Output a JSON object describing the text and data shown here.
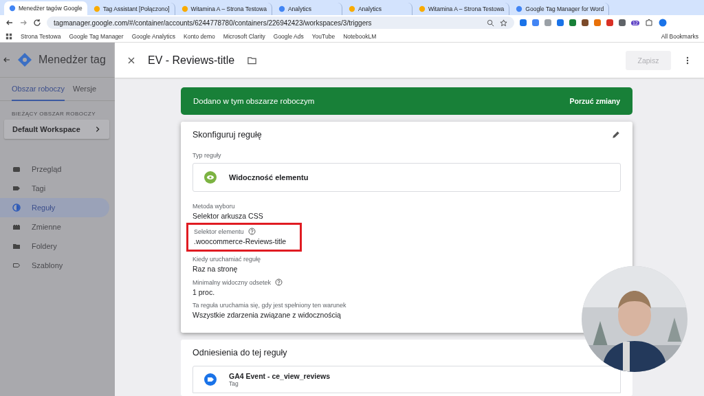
{
  "browser": {
    "tabs": [
      {
        "title": "Menedżer tagów Google",
        "selected": true
      },
      {
        "title": "Tag Assistant [Połączono]",
        "selected": false
      },
      {
        "title": "Witamina A – Strona Testowa",
        "selected": false
      },
      {
        "title": "Analytics",
        "selected": false
      },
      {
        "title": "Analytics",
        "selected": false
      },
      {
        "title": "Witamina A – Strona Testowa",
        "selected": false
      },
      {
        "title": "Google Tag Manager for Word",
        "selected": false
      }
    ],
    "url": "tagmanager.google.com/#/container/accounts/6244778780/containers/226942423/workspaces/3/triggers",
    "extension_badge": "12",
    "bookmarks": [
      "Strona Testowa",
      "Google Tag Manager",
      "Google Analytics",
      "Konto demo",
      "Microsoft Clarity",
      "Google Ads",
      "YouTube",
      "NotebookLM"
    ],
    "all_bookmarks": "All Bookmarks"
  },
  "sidebar": {
    "app_title": "Menedżer tag",
    "tabs": [
      {
        "label": "Obszar roboczy",
        "selected": true
      },
      {
        "label": "Wersje",
        "selected": false
      }
    ],
    "workspace_label": "BIEŻĄCY OBSZAR ROBOCZY",
    "workspace": "Default Workspace",
    "items": [
      {
        "label": "Przegląd",
        "selected": false
      },
      {
        "label": "Tagi",
        "selected": false
      },
      {
        "label": "Reguły",
        "selected": true
      },
      {
        "label": "Zmienne",
        "selected": false
      },
      {
        "label": "Foldery",
        "selected": false
      },
      {
        "label": "Szablony",
        "selected": false
      }
    ]
  },
  "editor": {
    "title": "EV - Reviews-title",
    "save": "Zapisz",
    "banner": {
      "text": "Dodano w tym obszarze roboczym",
      "action": "Porzuć zmiany"
    },
    "config": {
      "heading": "Skonfiguruj regułę",
      "type_label": "Typ reguły",
      "type": "Widoczność elementu",
      "fields": [
        {
          "label": "Metoda wyboru",
          "value": "Selektor arkusza CSS",
          "help": false,
          "highlighted": false
        },
        {
          "label": "Selektor elementu",
          "value": ".woocommerce-Reviews-title",
          "help": true,
          "highlighted": true
        },
        {
          "label": "Kiedy uruchamiać regułę",
          "value": "Raz na stronę",
          "help": false,
          "highlighted": false
        },
        {
          "label": "Minimalny widoczny odsetek",
          "value": "1  proc.",
          "help": true,
          "highlighted": false
        },
        {
          "label": "Ta reguła uruchamia się, gdy jest spełniony ten warunek",
          "value": "Wszystkie zdarzenia związane z widocznością",
          "help": false,
          "highlighted": false
        }
      ]
    },
    "references": {
      "heading": "Odniesienia do tej reguły",
      "items": [
        {
          "name": "GA4 Event - ce_view_reviews",
          "type": "Tag"
        }
      ]
    }
  }
}
